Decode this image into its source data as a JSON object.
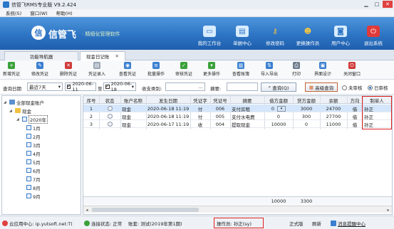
{
  "window": {
    "title": "信管飞RMS专业版 V9.2.424"
  },
  "menu": [
    "系统(S)",
    "窗口(W)",
    "帮助(H)"
  ],
  "banner": {
    "logo_char": "信",
    "brand": "信管飞",
    "slogan": "· 精细化管理软件"
  },
  "topnav": [
    {
      "label": "我的工作台",
      "icon": "monitor-icon",
      "color": "#d8ecff"
    },
    {
      "label": "单据中心",
      "icon": "document-center-icon",
      "color": "#d8ecff"
    },
    {
      "label": "修改密码",
      "icon": "key-icon",
      "color": "#f5c842"
    },
    {
      "label": "更换操作员",
      "icon": "user-switch-icon",
      "color": "#f5c842"
    },
    {
      "label": "用户中心",
      "icon": "user-center-icon",
      "color": "#d8ecff"
    },
    {
      "label": "退出系统",
      "icon": "power-icon",
      "color": "#e03a3a"
    }
  ],
  "tabs": [
    {
      "label": "功能导航器",
      "active": false
    },
    {
      "label": "现金日记账",
      "active": true,
      "close": "✕"
    }
  ],
  "toolbar": [
    {
      "label": "新增凭证",
      "icon": "add-icon",
      "color": "#3aa13a"
    },
    {
      "label": "修改凭证",
      "icon": "edit-icon",
      "color": "#3a7fd0"
    },
    {
      "label": "删除凭证",
      "icon": "delete-icon",
      "color": "#d03a3a"
    },
    {
      "label": "凭证录入",
      "icon": "entry-icon",
      "color": "#9aa6b4"
    },
    {
      "label": "查看凭证",
      "icon": "view-icon",
      "color": "#3a7fd0"
    },
    {
      "label": "批量操作",
      "icon": "batch-icon",
      "color": "#3a7fd0"
    },
    {
      "label": "审核凭证",
      "icon": "audit-icon",
      "color": "#3aa13a"
    },
    {
      "label": "更多操作",
      "icon": "more-icon",
      "color": "#3aa13a"
    },
    {
      "label": "查看账簿",
      "icon": "ledger-icon",
      "color": "#3a7fd0"
    },
    {
      "label": "导入导出",
      "icon": "import-export-icon",
      "color": "#3a7fd0"
    },
    {
      "label": "打印",
      "icon": "print-icon",
      "color": "#6a7a8c"
    },
    {
      "label": "界面设计",
      "icon": "design-icon",
      "color": "#3a7fd0"
    },
    {
      "label": "关闭窗口",
      "icon": "close-window-icon",
      "color": "#d03a3a"
    }
  ],
  "filter": {
    "date_label": "查询日期",
    "period": "最近7天",
    "start": "2020-06-11",
    "to": "至",
    "end": "2020-06-18",
    "type_label": "收支类别:",
    "type_value": "",
    "summary_label": "摘要:",
    "summary_value": "",
    "query_btn": "查询(Q)",
    "adv_btn": "高级查询",
    "unaudited": "未审核",
    "audited": "已审核"
  },
  "tree": {
    "root": "全部现金账户",
    "account": "现金",
    "year": "2020年",
    "months": [
      "1月",
      "2月",
      "3月",
      "4月",
      "5月",
      "6月",
      "7月",
      "8月",
      "9月"
    ]
  },
  "grid": {
    "columns": [
      "序号",
      "状态",
      "账户名称",
      "发生日期",
      "凭证字",
      "凭证号",
      "摘要",
      "借方金额",
      "贷方金额",
      "余额",
      "方向",
      "制单人"
    ],
    "rows": [
      [
        "1",
        "",
        "现金",
        "2020-06-18 11:19",
        "付",
        "006",
        "支付房租",
        "0",
        "3000",
        "24700",
        "借",
        "孙正"
      ],
      [
        "2",
        "",
        "现金",
        "2020-06-18 11:19",
        "付",
        "005",
        "支付水电费",
        "0",
        "300",
        "27700",
        "借",
        "孙正"
      ],
      [
        "3",
        "",
        "现金",
        "2020-06-17 11:19",
        "收",
        "004",
        "提取现金",
        "10000",
        "0",
        "11000",
        "借",
        "孙正"
      ]
    ],
    "totals": {
      "debit": "10000",
      "credit": "3300"
    }
  },
  "status": {
    "cloud": "云应用中心: ip.yutsoft.net:T(",
    "connect": "连接状态: 正常",
    "ledger": "账套: 测试(2019年第1期)",
    "operator": "操作员: 孙正(sy)",
    "edition": "正式版",
    "refresh": "刷新",
    "msg": "消息提醒中心"
  }
}
